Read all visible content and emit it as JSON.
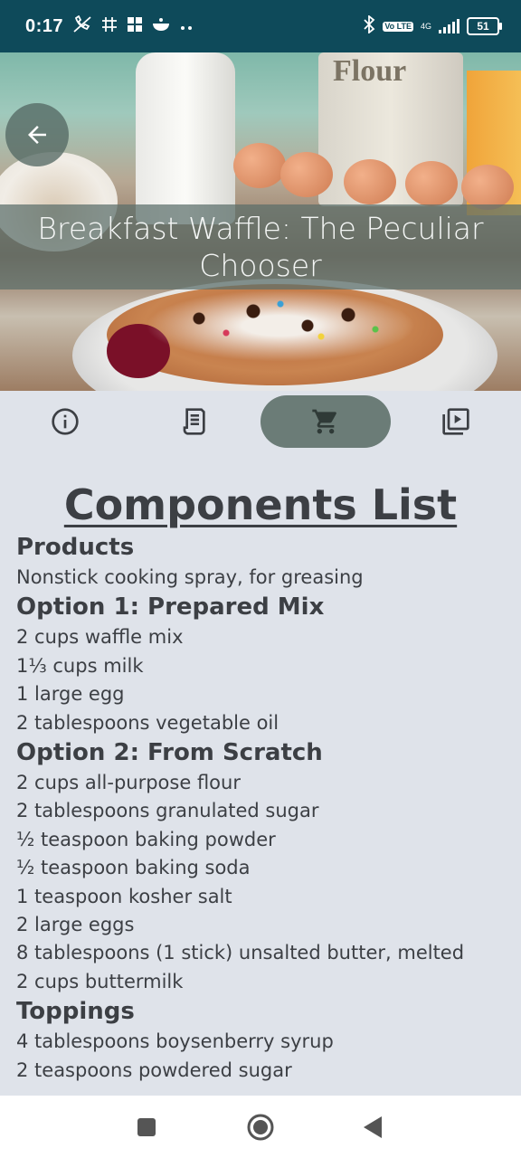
{
  "status_bar": {
    "time": "0:17",
    "lte_label": "Vo LTE",
    "network": "4G",
    "battery": "51"
  },
  "header": {
    "title": "Breakfast Waffle: The Peculiar Chooser",
    "hero_text": "Flour"
  },
  "tabs": [
    {
      "name": "info",
      "icon": "info-icon",
      "active": false
    },
    {
      "name": "recipe",
      "icon": "receipt-icon",
      "active": false
    },
    {
      "name": "ingredients",
      "icon": "cart-icon",
      "active": true
    },
    {
      "name": "video",
      "icon": "video-library-icon",
      "active": false
    }
  ],
  "content": {
    "heading": "Components List",
    "sections": [
      {
        "title": "Products",
        "items": [
          "Nonstick cooking spray, for greasing"
        ]
      },
      {
        "title": "Option 1: Prepared Mix",
        "items": [
          "2 cups waffle mix",
          "1⅓ cups milk",
          "1 large egg",
          "2 tablespoons vegetable oil"
        ]
      },
      {
        "title": "Option 2: From Scratch",
        "items": [
          "2 cups all-purpose flour",
          "2 tablespoons granulated sugar",
          "½ teaspoon baking powder",
          "½ teaspoon baking soda",
          "1  teaspoon kosher salt",
          "2 large eggs",
          "8 tablespoons (1 stick) unsalted butter, melted",
          "2 cups buttermilk"
        ]
      },
      {
        "title": "Toppings",
        "items": [
          "4 tablespoons boysenberry syrup",
          "2 teaspoons powdered sugar"
        ]
      }
    ]
  },
  "colors": {
    "status_bar": "#0e4a5a",
    "background": "#dfe3ea",
    "active_tab": "#6b7c77",
    "text": "#3c3f44"
  }
}
